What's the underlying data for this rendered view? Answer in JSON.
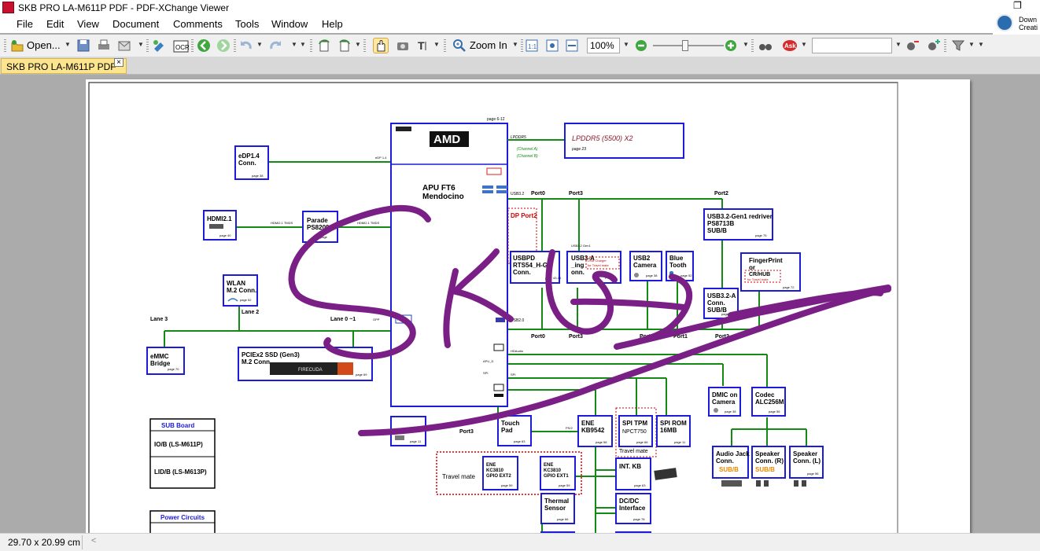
{
  "window": {
    "title": "SKB PRO LA-M611P PDF - PDF-XChange Viewer"
  },
  "promo": {
    "line1": "Down",
    "line2": "Creati"
  },
  "menu": [
    "File",
    "Edit",
    "View",
    "Document",
    "Comments",
    "Tools",
    "Window",
    "Help"
  ],
  "toolbar": {
    "open_label": "Open...",
    "zoom_in_label": "Zoom In",
    "zoom_value": "100%",
    "search_value": ""
  },
  "tab": {
    "label": "SKB PRO LA-M611P PDF",
    "close": "×"
  },
  "status": {
    "page_size": "29.70 x 20.99 cm",
    "arrow": "<"
  },
  "schematic": {
    "amd": "AMD",
    "apu_line1": "APU FT6",
    "apu_line2": "Mendocino",
    "page_apu": "page 6-12",
    "lpddr5_label": "LPDDR5",
    "channel_a": "(Channel A)",
    "channel_b": "(Channel B)",
    "lpddr": "LPDDR5 (5500) X2",
    "lpddr_page": "page 23",
    "edp_1": "eDP1.4",
    "edp_2": "Conn.",
    "edp_page": "page 38",
    "edp_bus": "eDP 1.4",
    "hdmi_1": "HDMI2.1",
    "hdmi_page": "page 40",
    "hdmi_bus1": "HDMI2.1 TMDS",
    "hdmi_bus2": "HDMI2.1 TMDS",
    "parade_1": "Parade",
    "parade_2": "PS8209",
    "parade_page": "page",
    "dp_port2": "DP Port2",
    "wlan_1": "WLAN",
    "wlan_2": "M.2 Conn.",
    "wlan_page": "page 52",
    "lane3": "Lane 3",
    "lane2": "Lane 2",
    "lane01": "Lane 0 ~1",
    "gpp": "GPP",
    "pcie": "PCIe",
    "emmc_1": "eMMC",
    "emmc_2": "Bridge",
    "emmc_page": "page 70",
    "ssd_1": "PCIEx2 SSD (Gen3)",
    "ssd_2": "M.2 Conn.",
    "ssd_page": "page 69",
    "ssd_brand": "FIRECUDA",
    "usb32": "USB3.2",
    "usb20": "USB2.0",
    "hdaudio": "HDAudio",
    "apu_d": "APU_D",
    "spi": "SPI",
    "port0a": "Port0",
    "port3a": "Port3",
    "port2a": "Port2",
    "port0b": "Port0",
    "port3b": "Port3",
    "port5": "Port5",
    "port1": "Port1",
    "port2b": "Port2",
    "usbpd_1": "USBPD",
    "usbpd_2": "RTS54_H-GR",
    "usbpd_3": "Conn.",
    "usbpd_page": "page 43,44",
    "usb3gen1": "USB3.2 Gen1",
    "usb3a_1": "USB3-A",
    "usb3a_2": "_ing",
    "usb3a_3": "onn.",
    "usb3a_page": "page 71",
    "usb_charger_1": "USB Charger",
    "usb_charger_2": "for Travel mate",
    "usb2cam_1": "USB2",
    "usb2cam_2": "Camera",
    "usb2cam_page": "page 38",
    "bt_1": "Blue",
    "bt_2": "Tooth",
    "bt_page": "page 52",
    "redriver_1": "USB3.2-Gen1 redriver",
    "redriver_2": "PS8713B",
    "redriver_3": "SUB/B",
    "redriver_page": "page 75",
    "finger_1": "FingerPrint",
    "finger_2": "or",
    "finger_3": "CR/HUB",
    "finger_4": "for Travel mate",
    "finger_page": "page 72",
    "usb32a_1": "USB3.2-A",
    "usb32a_2": "Conn.",
    "usb32a_3": "SUB/B",
    "usb32a_page": "page 75",
    "dmic_1": "DMIC on",
    "dmic_2": "Camera",
    "dmic_page": "page 38",
    "codec_1": "Codec",
    "codec_2": "ALC256M",
    "codec_page": "page 56",
    "touch_1": "Touch",
    "touch_2": "Pad",
    "touch_page": "page 63",
    "port3c": "Port3",
    "ps2": "PS/2",
    "ene_1": "ENE",
    "ene_2": "KB9542",
    "ene_page": "page 58",
    "tpm_1": "SPI TPM",
    "tpm_2": "NPCT750",
    "tpm_page": "page 66",
    "tpm_travel": "Travel mate",
    "rom_1": "SPI ROM",
    "rom_2": "16MB",
    "rom_page": "page 11",
    "small_page": "page 11",
    "audio_1": "Audio Jack",
    "audio_2": "Conn.",
    "audio_3": "SUB/B",
    "spkr_1": "Speaker",
    "spkr_2": "Conn. (R)",
    "spkr_3": "SUB/B",
    "spkl_1": "Speaker",
    "spkl_2": "Conn. (L)",
    "spkl_page": "page 56",
    "travel_mate": "Travel mate",
    "ext2_1": "ENE",
    "ext2_2": "KC3810",
    "ext2_3": "GPIO EXT2",
    "ext2_page": "page 59",
    "ext1_1": "ENE",
    "ext1_2": "KC3810",
    "ext1_3": "GPIO EXT1",
    "ext1_page": "page 59",
    "intkb": "INT. KB",
    "intkb_page": "page 63",
    "thermal_1": "Thermal",
    "thermal_2": "Sensor",
    "thermal_page": "page 66",
    "dcdc_1": "DC/DC",
    "dcdc_2": "Interface",
    "dcdc_page": "page 78",
    "sub_board": "SUB Board",
    "iob": "IO/B (LS-M611P)",
    "lidb": "LID/B (LS-M613P)",
    "power": "Power Circuits"
  }
}
